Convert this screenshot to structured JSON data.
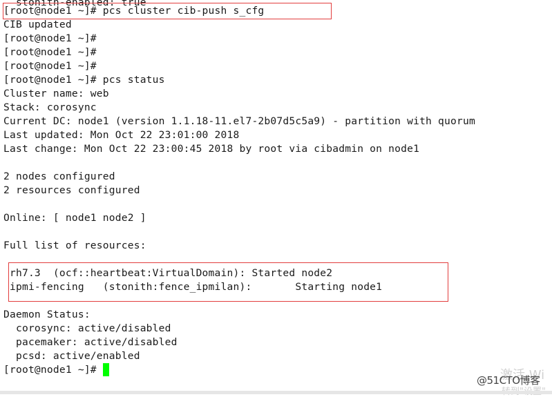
{
  "terminal": {
    "lines": [
      "  stonith-enabled: true",
      "[root@node1 ~]# pcs cluster cib-push s_cfg",
      "CIB updated",
      "[root@node1 ~]#",
      "[root@node1 ~]#",
      "[root@node1 ~]#",
      "[root@node1 ~]# pcs status",
      "Cluster name: web",
      "Stack: corosync",
      "Current DC: node1 (version 1.1.18-11.el7-2b07d5c5a9) - partition with quorum",
      "Last updated: Mon Oct 22 23:01:00 2018",
      "Last change: Mon Oct 22 23:00:45 2018 by root via cibadmin on node1",
      "",
      "2 nodes configured",
      "2 resources configured",
      "",
      "Online: [ node1 node2 ]",
      "",
      "Full list of resources:",
      "",
      " rh7.3  (ocf::heartbeat:VirtualDomain): Started node2",
      " ipmi-fencing   (stonith:fence_ipmilan):       Starting node1",
      "",
      "Daemon Status:",
      "  corosync: active/disabled",
      "  pacemaker: active/disabled",
      "  pcsd: active/enabled",
      "[root@node1 ~]# "
    ],
    "cursor_color": "#00ff00",
    "text_color": "#1a1a1a",
    "background_color": "#ffffff"
  },
  "annotations": {
    "highlight_color": "#e23c3c",
    "boxes": [
      {
        "label": "cib-push command"
      },
      {
        "label": "resource list"
      }
    ]
  },
  "watermarks": {
    "brand": "@51CTO博客",
    "activate_windows": "激活 Wi",
    "go_to_settings": "转到\"设置\""
  }
}
